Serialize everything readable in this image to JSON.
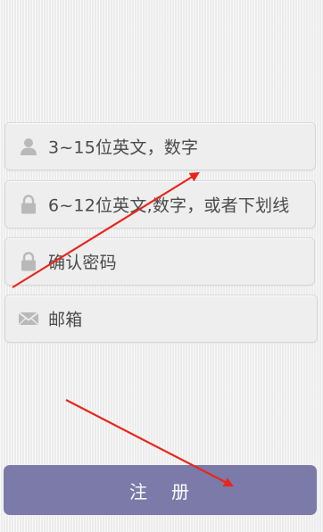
{
  "form": {
    "username_placeholder": "3~15位英文，数字",
    "password_placeholder": "6~12位英文,数字，或者下划线",
    "confirm_placeholder": "确认密码",
    "email_placeholder": "邮箱"
  },
  "icons": {
    "username": "user-icon",
    "password": "lock-icon",
    "confirm": "lock-icon",
    "email": "mail-icon"
  },
  "register_button": {
    "label": "注   册"
  },
  "colors": {
    "background": "#f1f1f1",
    "field_background": "#eeeeee",
    "field_border": "#d6d6d6",
    "button": "#7b7aa9",
    "annotation_arrow": "#e8261c",
    "icon_gray": "#b9b9b9",
    "text": "#4a4a4a"
  }
}
